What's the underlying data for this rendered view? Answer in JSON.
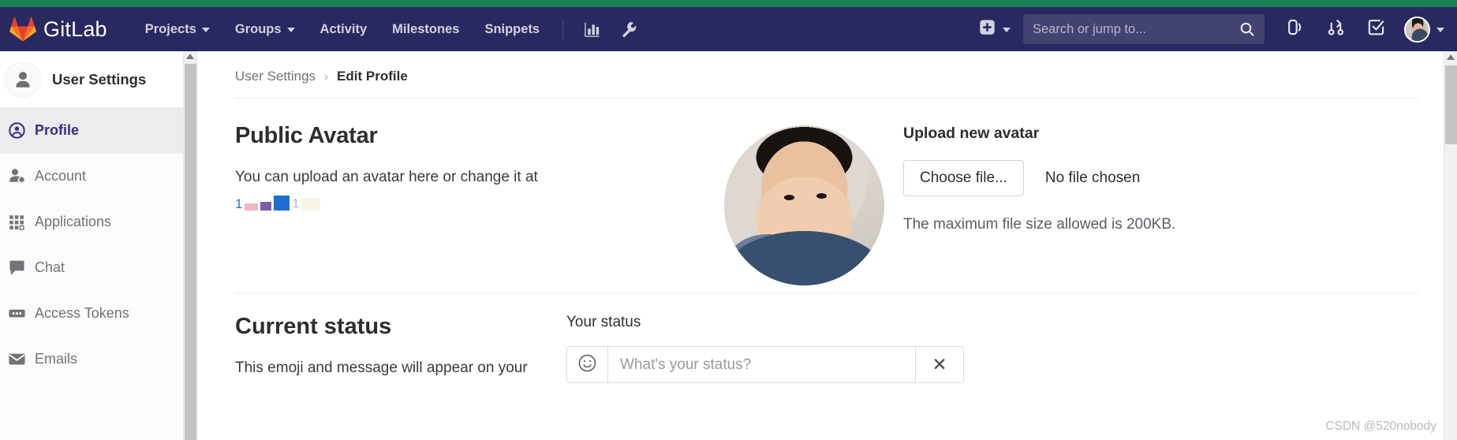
{
  "navbar": {
    "brand": "GitLab",
    "links": [
      {
        "label": "Projects",
        "has_caret": true
      },
      {
        "label": "Groups",
        "has_caret": true
      },
      {
        "label": "Activity",
        "has_caret": false
      },
      {
        "label": "Milestones",
        "has_caret": false
      },
      {
        "label": "Snippets",
        "has_caret": false
      }
    ],
    "icons": {
      "analytics": "analytics-chart-icon",
      "admin": "wrench-icon",
      "create_new": "plus-square-icon",
      "issues": "issues-icon",
      "merge_requests": "merge-request-icon",
      "todos": "todos-checkbox-icon",
      "user_menu": "user-avatar"
    },
    "search": {
      "placeholder": "Search or jump to...",
      "value": "",
      "icon": "search-icon"
    }
  },
  "sidebar": {
    "header_title": "User Settings",
    "header_icon": "user-icon",
    "items": [
      {
        "label": "Profile",
        "icon": "profile-icon",
        "active": true
      },
      {
        "label": "Account",
        "icon": "account-gear-icon",
        "active": false
      },
      {
        "label": "Applications",
        "icon": "applications-grid-icon",
        "active": false
      },
      {
        "label": "Chat",
        "icon": "chat-bubble-icon",
        "active": false
      },
      {
        "label": "Access Tokens",
        "icon": "token-icon",
        "active": false
      },
      {
        "label": "Emails",
        "icon": "envelope-icon",
        "active": false
      }
    ]
  },
  "breadcrumb": {
    "root": "User Settings",
    "separator": "›",
    "current": "Edit Profile"
  },
  "public_avatar": {
    "title": "Public Avatar",
    "description": "You can upload an avatar here or change it at",
    "broken_link_text": "1",
    "broken_link_tail": "1"
  },
  "upload": {
    "title": "Upload new avatar",
    "choose_button": "Choose file...",
    "file_status": "No file chosen",
    "max_size_note": "The maximum file size allowed is 200KB."
  },
  "current_status": {
    "title": "Current status",
    "description": "This emoji and message will appear on your",
    "your_status_label": "Your status",
    "status_placeholder": "What's your status?",
    "status_value": "",
    "emoji_icon": "smiley-face-icon",
    "clear_icon": "close-x-icon",
    "clear_label": "✕"
  },
  "watermark": "CSDN @520nobody",
  "colors": {
    "green_strip": "#1a7f55",
    "navbar": "#292961",
    "search_field": "#434372",
    "active_item_text": "#393081",
    "active_item_bg": "#ececef",
    "link_blue": "#1f75cb"
  }
}
